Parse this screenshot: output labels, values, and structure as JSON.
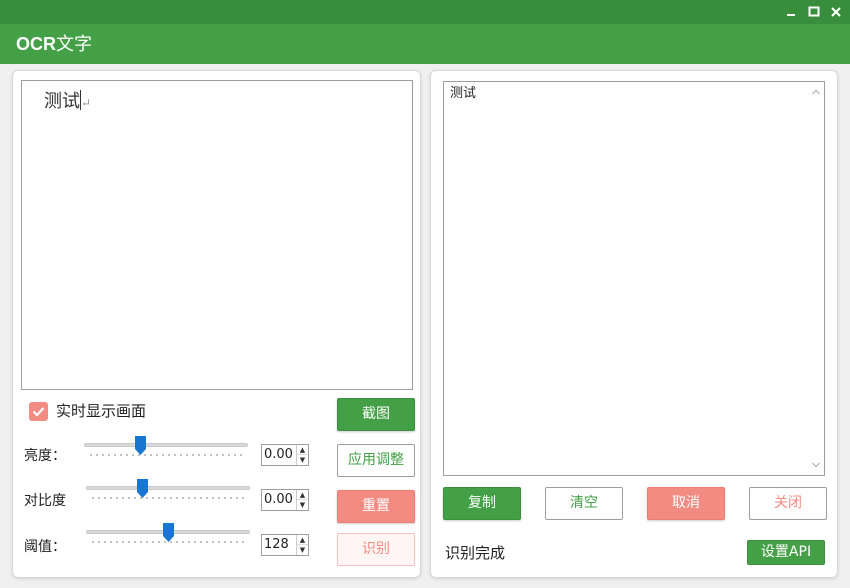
{
  "window": {
    "controls": {
      "minimize": "minimize-icon",
      "maximize": "maximize-icon",
      "close": "close-icon"
    }
  },
  "header": {
    "title_latin": "OCR",
    "title_cjk": "文字"
  },
  "preview": {
    "text": "测试"
  },
  "realtime": {
    "label": "实时显示画面",
    "checked": true
  },
  "adjustments": {
    "brightness": {
      "label": "亮度：",
      "value": "0.00"
    },
    "contrast": {
      "label": "对比度",
      "value": "0.00"
    },
    "threshold": {
      "label": "阈值：",
      "value": "128"
    }
  },
  "left_buttons": {
    "capture": "截图",
    "apply": "应用调整",
    "reset": "重置",
    "recognize": "识别"
  },
  "result": {
    "text": "测试"
  },
  "right_buttons": {
    "copy": "复制",
    "clear": "清空",
    "cancel": "取消",
    "close": "关闭",
    "set_api": "设置API"
  },
  "status": {
    "text": "识别完成"
  },
  "colors": {
    "primary": "#43a047",
    "titlebar": "#388e3c",
    "accent": "#f28b82",
    "thumb": "#1976d2"
  }
}
